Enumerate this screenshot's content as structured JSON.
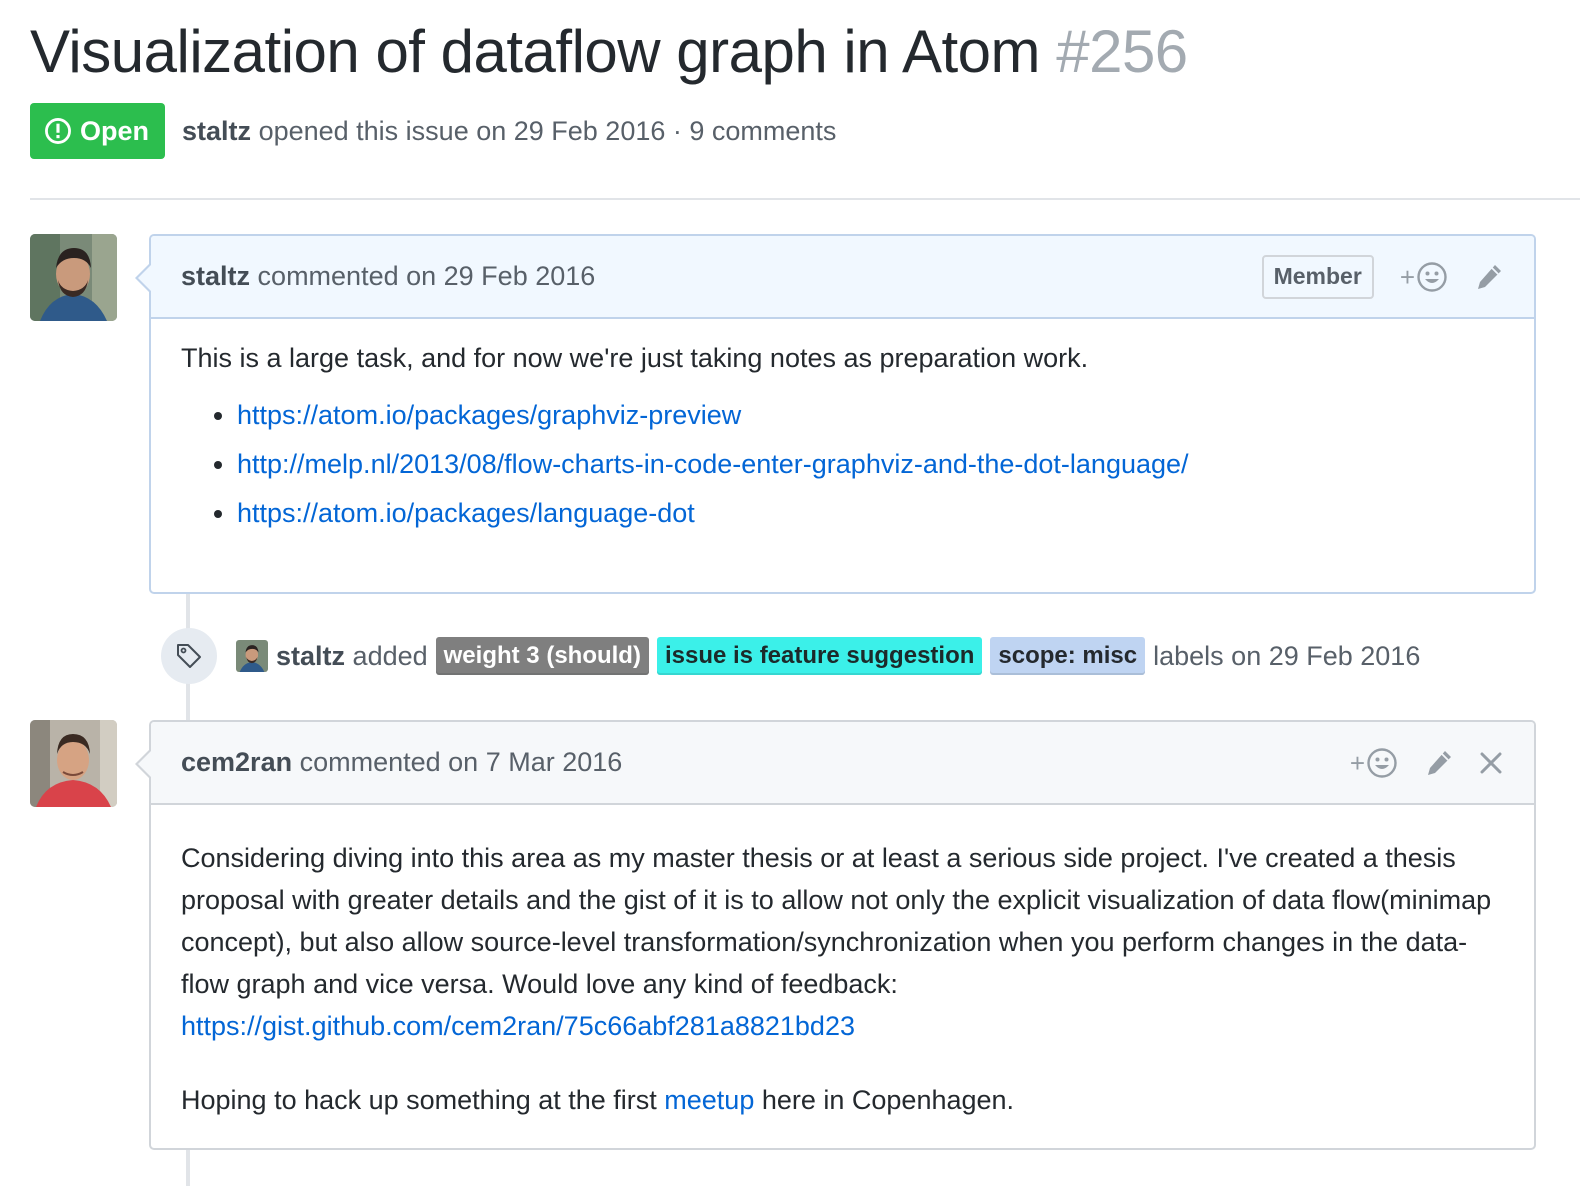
{
  "issue": {
    "title": "Visualization of dataflow graph in Atom",
    "number": "#256",
    "state": "Open",
    "author": "staltz",
    "opened_text": "opened this issue on 29 Feb 2016 · 9 comments"
  },
  "comments": [
    {
      "author": "staltz",
      "action_text": "commented on 29 Feb 2016",
      "badge": "Member",
      "reaction_plus": "+",
      "intro": "This is a large task, and for now we're just taking notes as preparation work.",
      "links": [
        "https://atom.io/packages/graphviz-preview",
        "http://melp.nl/2013/08/flow-charts-in-code-enter-graphviz-and-the-dot-language/",
        "https://atom.io/packages/language-dot"
      ]
    },
    {
      "author": "cem2ran",
      "action_text": "commented on 7 Mar 2016",
      "reaction_plus": "+",
      "para1": "Considering diving into this area as my master thesis or at least a serious side project. I've created a thesis proposal with greater details and the gist of it is to allow not only the explicit visualization of data flow(minimap concept), but also allow source-level transformation/synchronization when you perform changes in the data-flow graph and vice versa. Would love any kind of feedback:",
      "para1_link": "https://gist.github.com/cem2ran/75c66abf281a8821bd23",
      "para2_before": "Hoping to hack up something at the first ",
      "para2_link": "meetup",
      "para2_after": " here in Copenhagen."
    }
  ],
  "label_event": {
    "actor": "staltz",
    "verb": "added",
    "labels": [
      {
        "name": "weight 3 (should)",
        "bg": "#7f7f7f",
        "fg": "#ffffff"
      },
      {
        "name": "issue is feature suggestion",
        "bg": "#3bf0e9",
        "fg": "#1c2a2a"
      },
      {
        "name": "scope: misc",
        "bg": "#bfd4f2",
        "fg": "#24292e"
      }
    ],
    "suffix": "labels on 29 Feb 2016"
  },
  "colors": {
    "open_green": "#2cbe4e",
    "link_blue": "#0366d6",
    "muted_text": "#586069"
  }
}
